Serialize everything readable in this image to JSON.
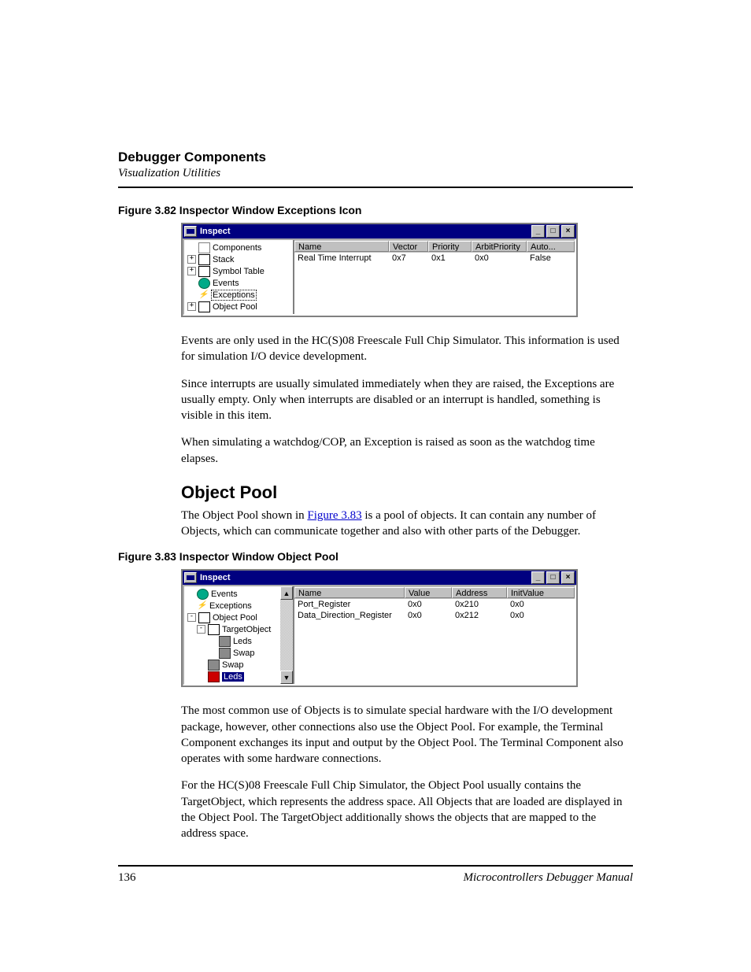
{
  "header": {
    "section": "Debugger Components",
    "subsection": "Visualization Utilities"
  },
  "figures": {
    "f82": {
      "caption": "Figure 3.82  Inspector Window Exceptions Icon"
    },
    "f83": {
      "caption": "Figure 3.83  Inspector Window Object Pool"
    }
  },
  "win1": {
    "title": "Inspect",
    "tree": {
      "components": "Components",
      "stack": "Stack",
      "symtab": "Symbol Table",
      "events": "Events",
      "exceptions": "Exceptions",
      "pool": "Object Pool"
    },
    "cols": {
      "c1": "Name",
      "c2": "Vector",
      "c3": "Priority",
      "c4": "ArbitPriority",
      "c5": "Auto..."
    },
    "row": {
      "name": "Real Time Interrupt",
      "vector": "0x7",
      "priority": "0x1",
      "arbit": "0x0",
      "auto": "False"
    }
  },
  "para1": "Events are only used in the HC(S)08 Freescale Full Chip Simulator. This information is used for simulation I/O device development.",
  "para2": "Since interrupts are usually simulated immediately when they are raised, the Exceptions are usually empty. Only when interrupts are disabled or an interrupt is handled, something is visible in this item.",
  "para3": "When simulating a watchdog/COP, an Exception is raised as soon as the watchdog time elapses.",
  "h2": "Object Pool",
  "para4a": "The Object Pool shown in ",
  "para4link": "Figure 3.83",
  "para4b": " is a pool of objects. It can contain any number of Objects, which can communicate together and also with other parts of the Debugger.",
  "win2": {
    "title": "Inspect",
    "tree": {
      "events": "Events",
      "exceptions": "Exceptions",
      "pool": "Object Pool",
      "target": "TargetObject",
      "leds1": "Leds",
      "swap1": "Swap",
      "swap2": "Swap",
      "leds2": "Leds"
    },
    "cols": {
      "c1": "Name",
      "c2": "Value",
      "c3": "Address",
      "c4": "InitValue"
    },
    "rows": [
      {
        "name": "Port_Register",
        "value": "0x0",
        "address": "0x210",
        "init": "0x0"
      },
      {
        "name": "Data_Direction_Register",
        "value": "0x0",
        "address": "0x212",
        "init": "0x0"
      }
    ]
  },
  "para5": "The most common use of Objects is to simulate special hardware with the I/O development package, however, other connections also use the Object Pool. For example, the Terminal Component exchanges its input and output by the Object Pool. The Terminal Component also operates with some hardware connections.",
  "para6": "For the HC(S)08 Freescale Full Chip Simulator, the Object Pool usually contains the TargetObject, which represents the address space. All Objects that are loaded are displayed in the Object Pool. The TargetObject additionally shows the objects that are mapped to the address space.",
  "footer": {
    "page": "136",
    "manual": "Microcontrollers Debugger Manual"
  }
}
